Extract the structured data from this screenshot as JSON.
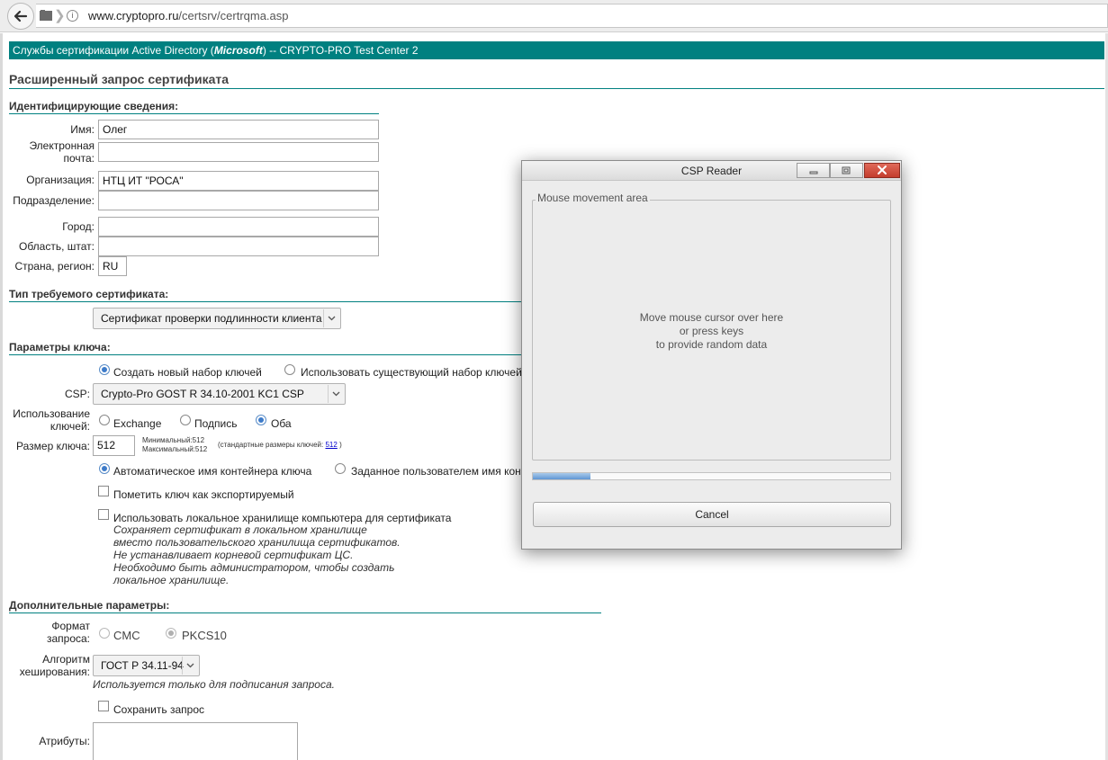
{
  "browser": {
    "url_host": "www.cryptopro.ru",
    "url_path": "/certsrv/certrqma.asp"
  },
  "banner": {
    "prefix": "Службы сертификации Active Directory (",
    "brand": "Microsoft",
    "suffix": ")  --  CRYPTO-PRO Test Center 2"
  },
  "page_title": "Расширенный запрос сертификата",
  "identity": {
    "heading": "Идентифицирующие сведения:",
    "name_label": "Имя:",
    "name_value": "Олег",
    "email_label_1": "Электронная",
    "email_label_2": "почта:",
    "email_value": "",
    "org_label": "Организация:",
    "org_value": "НТЦ ИТ \"РОСА\"",
    "dept_label": "Подразделение:",
    "dept_value": "",
    "city_label": "Город:",
    "city_value": "",
    "state_label": "Область, штат:",
    "state_value": "",
    "country_label": "Страна, регион:",
    "country_value": "RU"
  },
  "cert_type": {
    "heading": "Тип требуемого сертификата:",
    "selected": "Сертификат проверки подлинности клиента"
  },
  "key_params": {
    "heading": "Параметры ключа:",
    "new_keyset": "Создать новый набор ключей",
    "existing_keyset": "Использовать существующий набор ключей",
    "csp_label": "CSP:",
    "csp_selected": "Crypto-Pro GOST R 34.10-2001 KC1 CSP",
    "usage_label_1": "Использование",
    "usage_label_2": "ключей:",
    "usage_exchange": "Exchange",
    "usage_signature": "Подпись",
    "usage_both": "Оба",
    "size_label": "Размер ключа:",
    "size_value": "512",
    "size_min": "Минимальный:512",
    "size_max": "Максимальный:512",
    "size_std_prefix": "(стандартные размеры ключей:",
    "size_std_link": "512",
    "size_std_suffix": ")",
    "auto_container": "Автоматическое имя контейнера ключа",
    "user_container": "Заданное пользователем имя контейнера",
    "exportable": "Пометить ключ как экспортируемый",
    "local_store": "Использовать локальное хранилище компьютера для сертификата",
    "local_note_1": "Сохраняет сертификат в локальном хранилище",
    "local_note_2": "вместо пользовательского хранилища сертификатов.",
    "local_note_3": "Не устанавливает корневой сертификат ЦС.",
    "local_note_4": "Необходимо быть администратором, чтобы создать",
    "local_note_5": "локальное хранилище."
  },
  "extra": {
    "heading": "Дополнительные параметры:",
    "format_label_1": "Формат",
    "format_label_2": "запроса:",
    "format_cmc": "CMC",
    "format_pkcs10": "PKCS10",
    "hash_label_1": "Алгоритм",
    "hash_label_2": "хеширования:",
    "hash_selected": "ГОСТ Р 34.11-94",
    "hash_note": "Используется только для подписания запроса.",
    "save_request": "Сохранить запрос",
    "attrs_label": "Атрибуты:"
  },
  "dialog": {
    "title": "CSP Reader",
    "group_title": "Mouse movement area",
    "msg_1": "Move mouse cursor over here",
    "msg_2": "or press keys",
    "msg_3": "to provide random data",
    "progress": 0.16,
    "cancel": "Cancel"
  }
}
